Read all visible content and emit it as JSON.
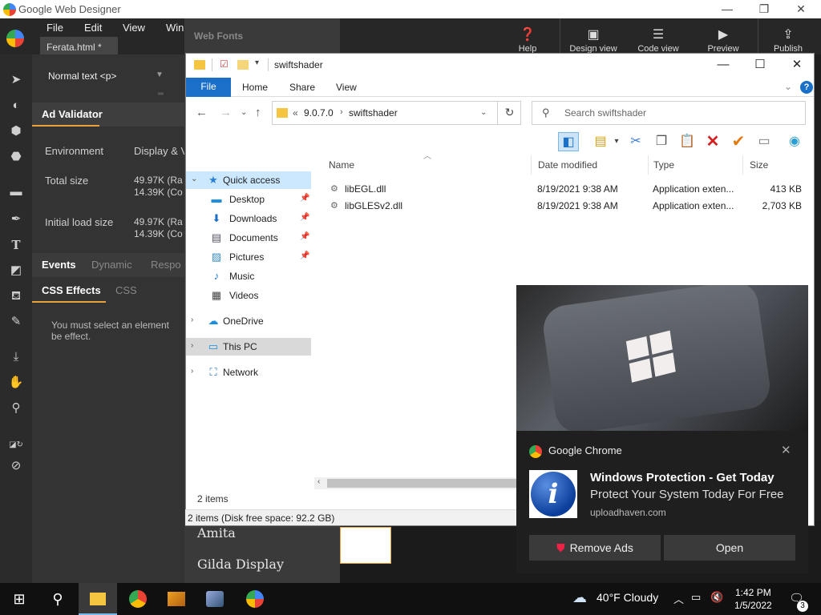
{
  "app": {
    "title": "Google Web Designer"
  },
  "menu": [
    "File",
    "Edit",
    "View",
    "Win"
  ],
  "file_tab": {
    "label": "Ferata.html *",
    "close": "×"
  },
  "right_tools": [
    {
      "label": "Help",
      "icon": "help-icon"
    },
    {
      "label": "Design view",
      "icon": "design-view-icon"
    },
    {
      "label": "Code view",
      "icon": "code-view-icon"
    },
    {
      "label": "Preview",
      "icon": "preview-icon"
    },
    {
      "label": "Publish",
      "icon": "publish-icon"
    }
  ],
  "panel": {
    "text_style": "Normal text <p>",
    "ad_validator": "Ad Validator",
    "environment_label": "Environment",
    "environment_value": "Display & V",
    "total_size_label": "Total size",
    "total_size_value": [
      "49.97K (Ra",
      "14.39K (Co"
    ],
    "initial_load_label": "Initial load size",
    "initial_load_value": [
      "49.97K (Ra",
      "14.39K (Co"
    ],
    "tabs1": [
      "Events",
      "Dynamic",
      "Respo"
    ],
    "tabs2": [
      "CSS Effects",
      "CSS"
    ],
    "message": "You must select an element be effect."
  },
  "web_fonts": {
    "title": "Web Fonts",
    "samples": [
      "Amita",
      "Gilda Display"
    ]
  },
  "explorer": {
    "title": "swiftshader",
    "ribbon_tabs": [
      "File",
      "Home",
      "Share",
      "View"
    ],
    "address": {
      "prefix": "«",
      "segments": [
        "9.0.7.0",
        "swiftshader"
      ]
    },
    "search_placeholder": "Search swiftshader",
    "nav": [
      {
        "label": "Quick access",
        "icon": "star-icon",
        "chev": "⌄",
        "pin": false,
        "selected": true
      },
      {
        "label": "Desktop",
        "icon": "desktop-icon",
        "pin": true
      },
      {
        "label": "Downloads",
        "icon": "download-icon",
        "pin": true
      },
      {
        "label": "Documents",
        "icon": "documents-icon",
        "pin": true
      },
      {
        "label": "Pictures",
        "icon": "pictures-icon",
        "pin": true
      },
      {
        "label": "Music",
        "icon": "music-icon",
        "pin": false
      },
      {
        "label": "Videos",
        "icon": "videos-icon",
        "pin": false
      },
      {
        "label": "OneDrive",
        "icon": "cloud-icon",
        "chev": "›"
      },
      {
        "label": "This PC",
        "icon": "pc-icon",
        "chev": "›",
        "highlight": true
      },
      {
        "label": "Network",
        "icon": "network-icon",
        "chev": "›"
      }
    ],
    "columns": [
      "Name",
      "Date modified",
      "Type",
      "Size"
    ],
    "files": [
      {
        "name": "libEGL.dll",
        "date": "8/19/2021 9:38 AM",
        "type": "Application exten...",
        "size": "413 KB"
      },
      {
        "name": "libGLESv2.dll",
        "date": "8/19/2021 9:38 AM",
        "type": "Application exten...",
        "size": "2,703 KB"
      }
    ],
    "status": "2 items",
    "status_strip": "2 items (Disk free space: 92.2 GB)"
  },
  "notification": {
    "source": "Google Chrome",
    "title": "Windows Protection - Get Today",
    "body": "Protect Your System Today For Free",
    "url": "uploadhaven.com",
    "buttons": [
      "Remove Ads",
      "Open"
    ]
  },
  "taskbar": {
    "weather": "40°F  Cloudy",
    "time": "1:42 PM",
    "date": "1/5/2022",
    "notif_count": "3"
  },
  "colors": {
    "accent_orange": "#e8a13b",
    "win_blue": "#1a6fc8",
    "delete_red": "#d61f1f",
    "check_orange": "#e07b10"
  }
}
